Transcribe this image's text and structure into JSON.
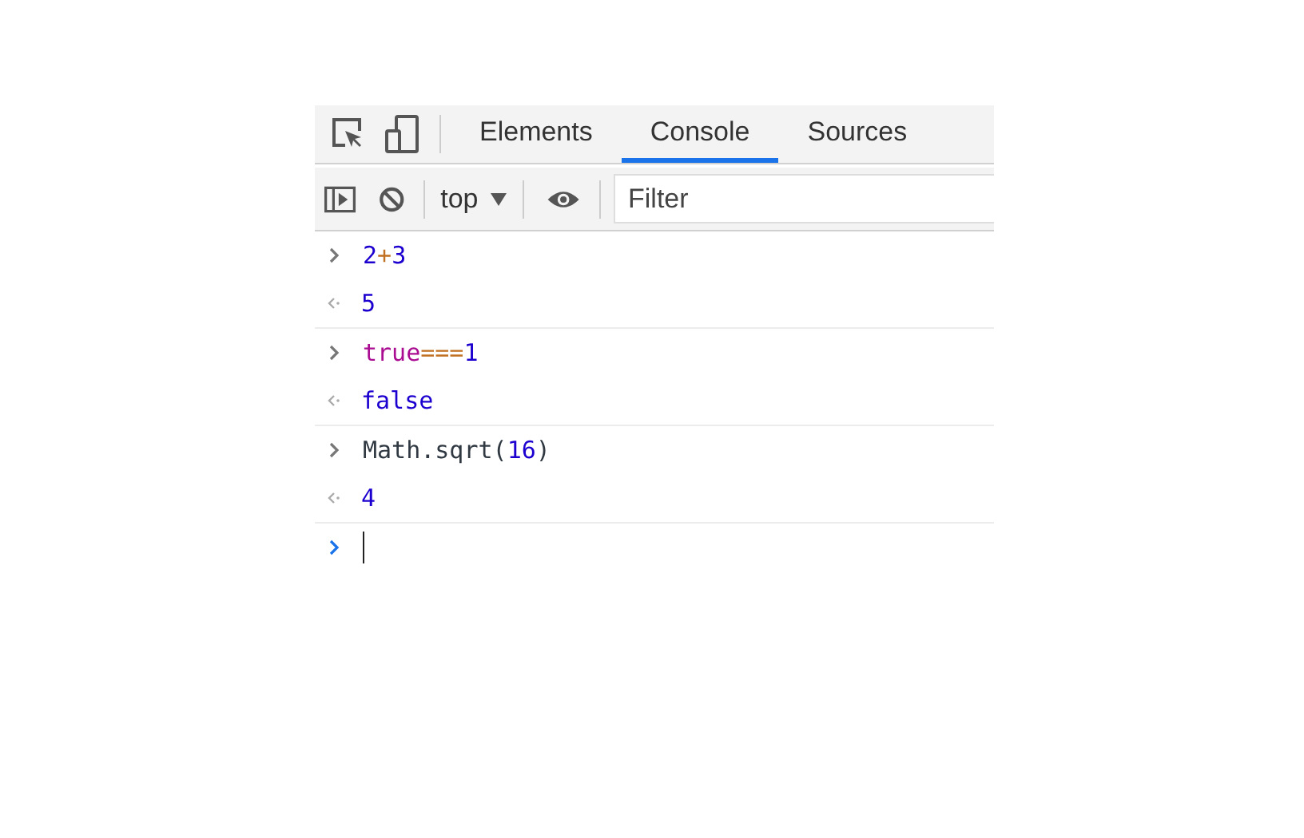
{
  "tabs": [
    {
      "label": "Elements",
      "selected": false
    },
    {
      "label": "Console",
      "selected": true
    },
    {
      "label": "Sources",
      "selected": false
    }
  ],
  "toolbar": {
    "context": "top",
    "filter": {
      "placeholder": "Filter"
    }
  },
  "entries": [
    {
      "input": [
        {
          "text": "2",
          "kind": "number"
        },
        {
          "text": "+",
          "kind": "operator"
        },
        {
          "text": "3",
          "kind": "number"
        }
      ],
      "result": "5"
    },
    {
      "input": [
        {
          "text": "true",
          "kind": "keyword"
        },
        {
          "text": "===",
          "kind": "operator"
        },
        {
          "text": "1",
          "kind": "number"
        }
      ],
      "result": "false"
    },
    {
      "input": [
        {
          "text": "Math.sqrt(",
          "kind": "plain"
        },
        {
          "text": "16",
          "kind": "number"
        },
        {
          "text": ")",
          "kind": "plain"
        }
      ],
      "result": "4"
    }
  ]
}
